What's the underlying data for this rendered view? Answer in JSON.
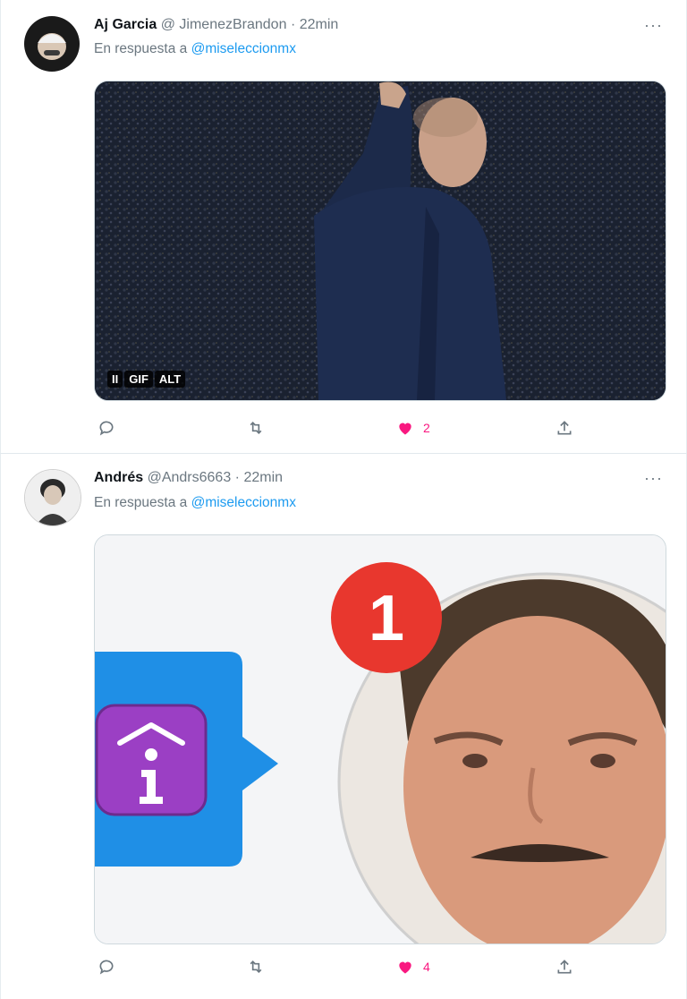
{
  "tweets": [
    {
      "name": "Aj Garcia",
      "handle": "@ JimenezBrandon",
      "time": "· 22min",
      "reply_prefix": "En respuesta a",
      "reply_to": "@miseleccionmx",
      "media_badges": [
        "II",
        "GIF",
        "ALT"
      ],
      "likes": "2"
    },
    {
      "name": "Andrés",
      "handle": "@Andrs6663",
      "time": "· 22min",
      "reply_prefix": "En respuesta a",
      "reply_to": "@miseleccionmx",
      "notification_count": "1",
      "likes": "4"
    }
  ],
  "more_label": "···",
  "colors": {
    "like": "#f91880",
    "mention": "#1d9bf0",
    "muted": "#6b7780"
  },
  "icons": [
    "reply-icon",
    "retweet-icon",
    "heart-icon",
    "share-icon",
    "more-icon",
    "info-icon"
  ]
}
